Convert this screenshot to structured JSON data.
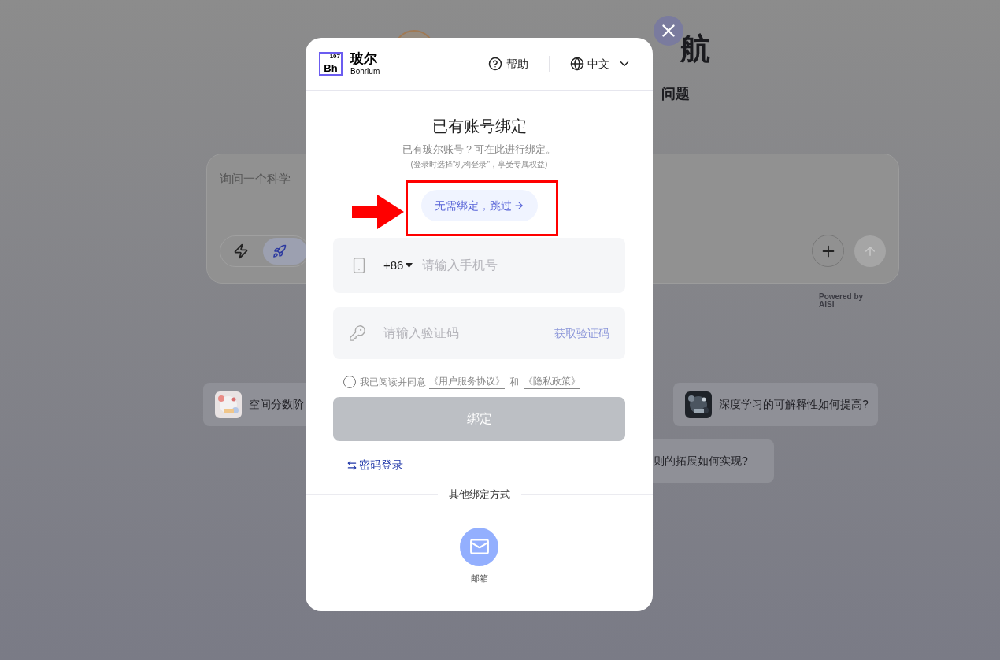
{
  "background": {
    "title": "航",
    "subtitle": "问题",
    "search_placeholder": "询问一个科学",
    "powered_by": [
      "Powered by",
      "AISI"
    ],
    "suggestions": [
      {
        "text": "空间分数阶"
      },
      {
        "text": "深度学习的可解释性如何提高?"
      },
      {
        "text": "则的拓展如何实现?"
      }
    ]
  },
  "dialog": {
    "brand": {
      "name": "玻尔",
      "sub": "Bohrium",
      "mark": "Bh",
      "number": "107"
    },
    "help": "帮助",
    "language": "中文",
    "title": "已有账号绑定",
    "subtitle": "已有玻尔账号？可在此进行绑定。",
    "hint": "(登录时选择\"机构登录\"，享受专属权益)",
    "skip_button": "无需绑定，跳过",
    "phone": {
      "country_code": "+86",
      "placeholder": "请输入手机号"
    },
    "code": {
      "placeholder": "请输入验证码",
      "action": "获取验证码"
    },
    "agreement": {
      "checked": false,
      "prefix": "我已阅读并同意",
      "terms": "《用户服务协议》",
      "and": "和",
      "privacy": "《隐私政策》"
    },
    "bind_button": {
      "label": "绑定",
      "disabled": true
    },
    "password_login": "密码登录",
    "other_methods": "其他绑定方式",
    "methods": [
      {
        "label": "邮箱"
      }
    ]
  }
}
